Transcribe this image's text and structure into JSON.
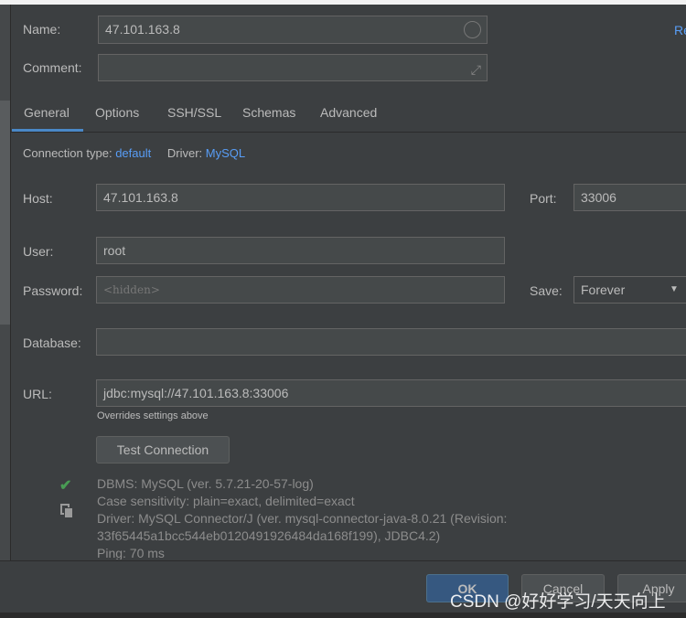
{
  "name": {
    "label": "Name:",
    "value": "47.101.163.8"
  },
  "comment": {
    "label": "Comment:",
    "value": ""
  },
  "reset_link": "Re",
  "tabs": [
    {
      "label": "General",
      "selected": true
    },
    {
      "label": "Options"
    },
    {
      "label": "SSH/SSL"
    },
    {
      "label": "Schemas"
    },
    {
      "label": "Advanced"
    }
  ],
  "conn": {
    "type_label": "Connection type:",
    "type_value": "default",
    "driver_label": "Driver:",
    "driver_value": "MySQL"
  },
  "host": {
    "label": "Host:",
    "value": "47.101.163.8"
  },
  "port": {
    "label": "Port:",
    "value": "33006"
  },
  "user": {
    "label": "User:",
    "value": "root"
  },
  "password": {
    "label": "Password:",
    "placeholder": "<hidden>"
  },
  "save": {
    "label": "Save:",
    "value": "Forever"
  },
  "database": {
    "label": "Database:",
    "value": ""
  },
  "url": {
    "label": "URL:",
    "value": "jdbc:mysql://47.101.163.8:33006",
    "hint": "Overrides settings above"
  },
  "test_button": "Test Connection",
  "result": {
    "status": "success",
    "lines": [
      "DBMS: MySQL (ver. 5.7.21-20-57-log)",
      "Case sensitivity: plain=exact, delimited=exact",
      "Driver: MySQL Connector/J (ver. mysql-connector-java-8.0.21 (Revision:",
      "33f65445a1bcc544eb0120491926484da168f199), JDBC4.2)",
      "Ping: 70 ms"
    ]
  },
  "buttons": {
    "ok": "OK",
    "cancel": "Cancel",
    "apply": "Apply"
  },
  "watermark": "CSDN @好好学习/天天向上",
  "colors": {
    "accent": "#4a88c7",
    "link": "#589df6",
    "success": "#499c54"
  }
}
